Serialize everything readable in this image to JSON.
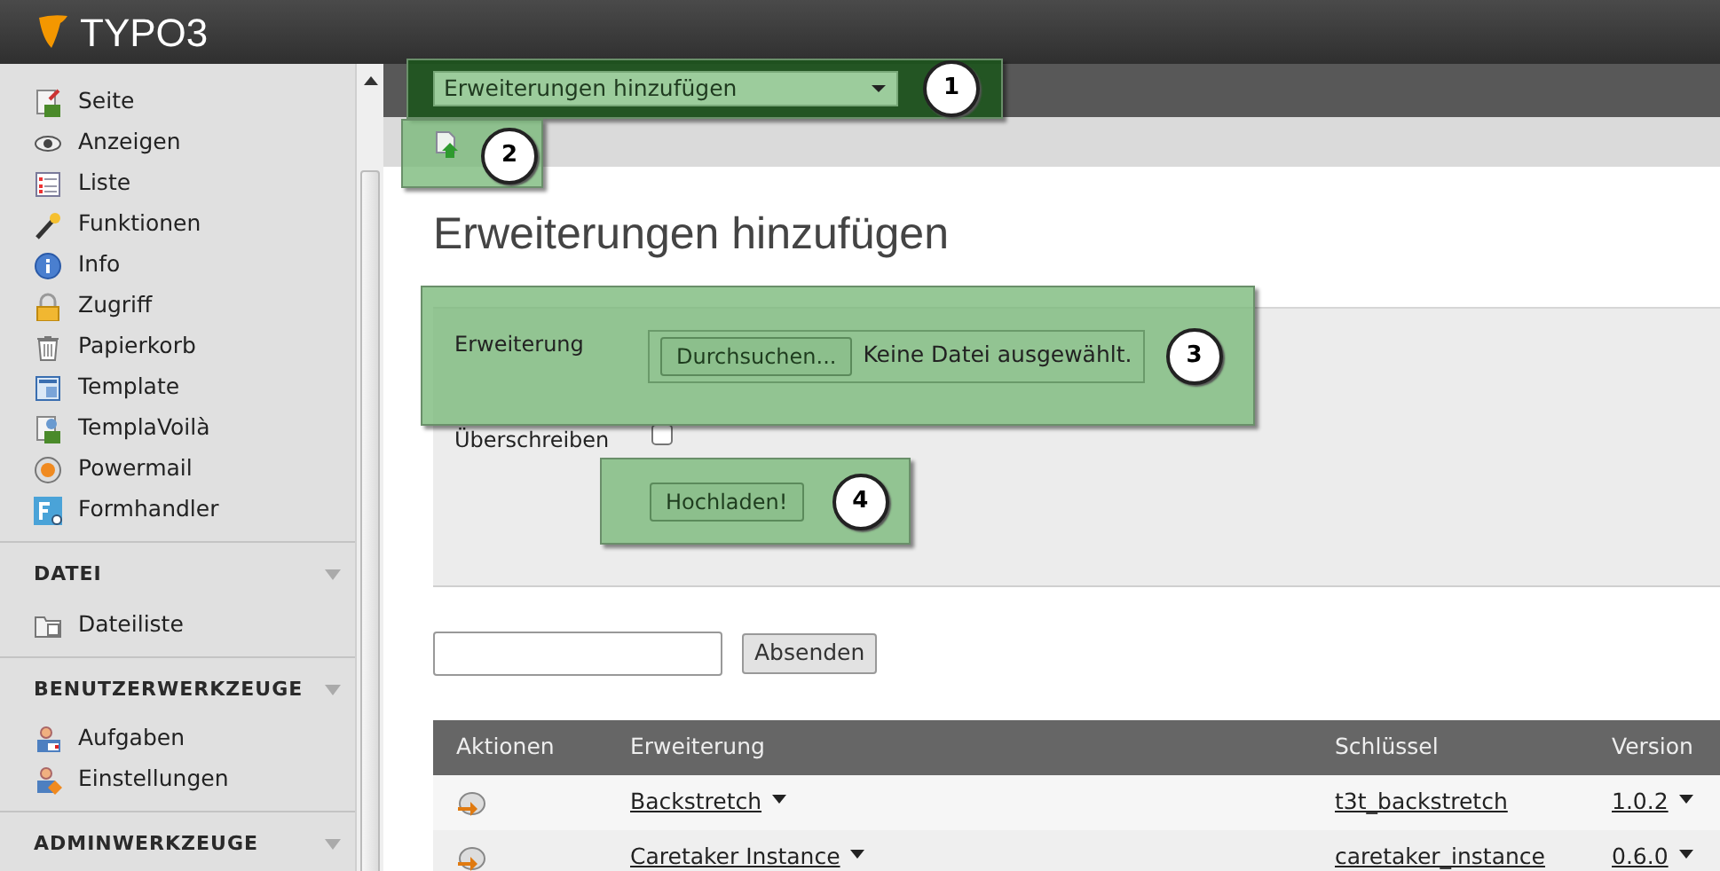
{
  "app": {
    "logo": "TYPO3"
  },
  "sidebar": {
    "groups": [
      {
        "items": [
          {
            "label": "Seite"
          },
          {
            "label": "Anzeigen"
          },
          {
            "label": "Liste"
          },
          {
            "label": "Funktionen"
          },
          {
            "label": "Info"
          },
          {
            "label": "Zugriff"
          },
          {
            "label": "Papierkorb"
          },
          {
            "label": "Template"
          },
          {
            "label": "TemplaVoilà"
          },
          {
            "label": "Powermail"
          },
          {
            "label": "Formhandler"
          }
        ]
      },
      {
        "title": "DATEI",
        "items": [
          {
            "label": "Dateiliste"
          }
        ]
      },
      {
        "title": "BENUTZERWERKZEUGE",
        "items": [
          {
            "label": "Aufgaben"
          },
          {
            "label": "Einstellungen"
          }
        ]
      },
      {
        "title": "ADMINWERKZEUGE"
      }
    ]
  },
  "module_menu": {
    "value": "Erweiterungen hinzufügen"
  },
  "page_title": "Erweiterungen hinzufügen",
  "upload_form": {
    "field_label": "Erweiterung",
    "browse_button": "Durchsuchen...",
    "file_status": "Keine Datei ausgewählt.",
    "overwrite_label": "Überschreiben",
    "overwrite_checked": false,
    "upload_button": "Hochladen!"
  },
  "search": {
    "submit_button": "Absenden"
  },
  "callouts": [
    {
      "number": "1"
    },
    {
      "number": "2"
    },
    {
      "number": "3"
    },
    {
      "number": "4"
    }
  ],
  "table": {
    "columns": [
      "Aktionen",
      "Erweiterung",
      "Schlüssel",
      "Version"
    ],
    "rows": [
      {
        "name": "Backstretch",
        "key": "t3t_backstretch",
        "version": "1.0.2"
      },
      {
        "name": "Caretaker Instance",
        "key": "caretaker_instance",
        "version": "0.6.0"
      }
    ]
  }
}
